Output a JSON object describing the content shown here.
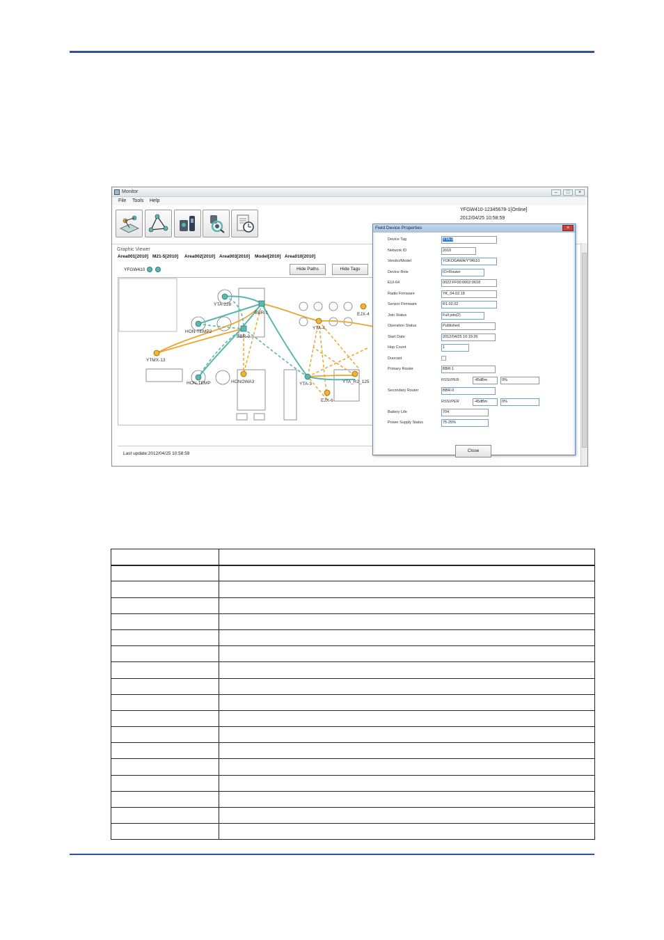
{
  "window": {
    "title": "Monitor",
    "menu": [
      "File",
      "Tools",
      "Help"
    ],
    "gateway_status": "YFGW410-12345678-1[Online]",
    "gateway_time": "2012/04/25 10:58:59",
    "viewer_label": "Graphic Viewer",
    "tabs": [
      "Area001[2010]",
      "M21-5[2010]",
      "Area002[2010]",
      "Area003[2010]",
      "Model[2010]",
      "Area010[2010]"
    ],
    "gateway_tag": "YFGW410",
    "hide_paths": "Hide Paths",
    "hide_tags": "Hide Tags",
    "status_text": "Last update:2012/04/25 10:58:59"
  },
  "map": {
    "tags": {
      "yta228": "YTA-228",
      "bbr1": "BBR-1",
      "hontemp2": "HON-TEMP2",
      "bbr0": "BBR-0",
      "ytmx13": "YTMX-13",
      "hontemp": "HON-TEMP",
      "honowa3": "HONOWA3",
      "yta3": "YTA-3",
      "ejx6": "EJX-6",
      "yta4": "YTA-4",
      "ejx4": "EJX-4",
      "ytar2": "YTA_R2_125"
    }
  },
  "dialog": {
    "title": "Field Device Properties",
    "fields": {
      "device_tag": {
        "label": "Device Tag",
        "value": "YTA-3"
      },
      "network_id": {
        "label": "Network ID",
        "value": "2010"
      },
      "vendor_model": {
        "label": "Vendor/Model",
        "value": "YOKOGAWA/YTA510"
      },
      "device_role": {
        "label": "Device Role",
        "value": "IO+Router"
      },
      "eui64": {
        "label": "EUI-64",
        "value": "0022:FF00:0002:0618"
      },
      "radio_fw": {
        "label": "Radio Firmware",
        "value": "YK_04.02.18"
      },
      "sensor_fw": {
        "label": "Sensor Firmware",
        "value": "R1.02.02"
      },
      "join_status": {
        "label": "Join Status",
        "value": "Full join(2)"
      },
      "op_status": {
        "label": "Operation Status",
        "value": "Published"
      },
      "start_date": {
        "label": "Start Date",
        "value": "2012/04/25 10:19:26"
      },
      "hop_count": {
        "label": "Hop Count",
        "value": "1"
      },
      "duocast": {
        "label": "Duocast"
      },
      "primary_router": {
        "label": "Primary Router",
        "value": "BBR-1",
        "rssi_label": "RSSI/PER",
        "rssi": "-45dBm",
        "per": "0%"
      },
      "secondary_router": {
        "label": "Secondary Router",
        "value": "BBR-0",
        "rssi_label": "RSSI/PER",
        "rssi": "-45dBm",
        "per": "0%"
      },
      "battery_life": {
        "label": "Battery Life",
        "value": "704"
      },
      "power_status": {
        "label": "Power Supply Status",
        "value": "75-25%"
      }
    },
    "close_label": "Close"
  }
}
